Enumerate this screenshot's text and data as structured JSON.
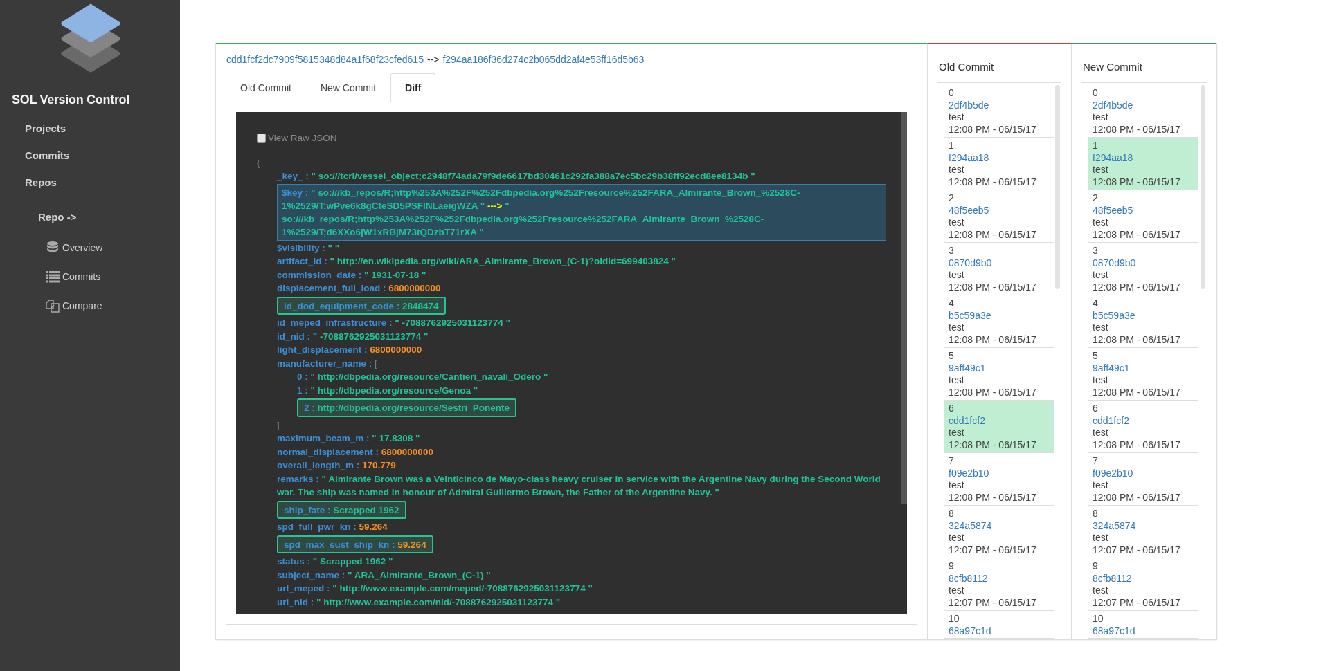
{
  "sidebar": {
    "title": "SOL Version Control",
    "nav": [
      {
        "label": "Projects"
      },
      {
        "label": "Commits"
      },
      {
        "label": "Repos"
      }
    ],
    "repo_heading": "Repo ->",
    "repo_items": [
      {
        "label": "Overview",
        "kind": "database"
      },
      {
        "label": "Commits",
        "kind": "list"
      },
      {
        "label": "Compare",
        "kind": "compare"
      }
    ]
  },
  "compare": {
    "old_hash": "cdd1fcf2dc7909f5815348d84a1f68f23cfed615",
    "arrow": "-->",
    "new_hash": "f294aa186f36d274c2b065dd2af4e53ff16d5b63"
  },
  "tabs": [
    {
      "label": "Old Commit",
      "selected": false
    },
    {
      "label": "New Commit",
      "selected": false
    },
    {
      "label": "Diff",
      "selected": true
    }
  ],
  "diff": {
    "raw_json": {
      "label": "View Raw JSON",
      "checked": false
    },
    "lines": [
      {
        "kind": "brace",
        "text": "{"
      },
      {
        "kind": "string",
        "key": "_key_ :",
        "value": "\" so:///tcri/vessel_object;c2948f74ada79f9de6617bd30461c292fa388a7ec5bc29b38ff92ecd8ee8134b \"",
        "highlighted": false
      },
      {
        "kind": "changed",
        "key": "$key :",
        "old": "\" so:///kb_repos/R;http%253A%252F%252Fdbpedia.org%252Fresource%252FARA_Almirante_Brown_%2528C-1%2529/T;wPve6k8gCteSD5PSFINLaeigWZA \"",
        "arrow": "--->",
        "new": "\" so:///kb_repos/R;http%253A%252F%252Fdbpedia.org%252Fresource%252FARA_Almirante_Brown_%2528C-1%2529/T;d6XXo6jW1xRBjM73tQDzbT71rXA \""
      },
      {
        "kind": "string",
        "key": "$visibility :",
        "value": "\" \"",
        "highlighted": false
      },
      {
        "kind": "string",
        "key": "artifact_id :",
        "value": "\" http://en.wikipedia.org/wiki/ARA_Almirante_Brown_(C-1)?oldid=699403824 \"",
        "highlighted": false
      },
      {
        "kind": "string",
        "key": "commission_date :",
        "value": "\" 1931-07-18 \"",
        "highlighted": false
      },
      {
        "kind": "number",
        "key": "displacement_full_load :",
        "value": "6800000000",
        "highlighted": false
      },
      {
        "kind": "string",
        "key": "id_dod_equipment_code :",
        "value": "2848474",
        "highlighted": true
      },
      {
        "kind": "string",
        "key": "id_meped_infrastructure :",
        "value": "\" -7088762925031123774 \"",
        "highlighted": false
      },
      {
        "kind": "string",
        "key": "id_nid :",
        "value": "\" -7088762925031123774 \"",
        "highlighted": false
      },
      {
        "kind": "number",
        "key": "light_displacement :",
        "value": "6800000000",
        "highlighted": false
      },
      {
        "kind": "array",
        "key": "manufacturer_name :",
        "open": "[",
        "close": "]",
        "items": [
          {
            "kind": "string",
            "key": "0 :",
            "value": "\" http://dbpedia.org/resource/Cantieri_navali_Odero \"",
            "highlighted": false
          },
          {
            "kind": "string",
            "key": "1 :",
            "value": "\" http://dbpedia.org/resource/Genoa \"",
            "highlighted": false
          },
          {
            "kind": "string",
            "key": "2 :",
            "value": "http://dbpedia.org/resource/Sestri_Ponente",
            "highlighted": true
          }
        ]
      },
      {
        "kind": "string",
        "key": "maximum_beam_m :",
        "value": "\" 17.8308 \"",
        "highlighted": false
      },
      {
        "kind": "number",
        "key": "normal_displacement :",
        "value": "6800000000",
        "highlighted": false
      },
      {
        "kind": "number",
        "key": "overall_length_m :",
        "value": "170.779",
        "highlighted": false
      },
      {
        "kind": "string",
        "key": "remarks :",
        "value": "\" Almirante Brown was a Veinticinco de Mayo-class heavy cruiser in service with the Argentine Navy during the Second World war. The ship was named in honour of Admiral Guillermo Brown, the Father of the Argentine Navy. \"",
        "highlighted": false
      },
      {
        "kind": "string",
        "key": "ship_fate :",
        "value": "Scrapped 1962",
        "highlighted": true
      },
      {
        "kind": "number",
        "key": "spd_full_pwr_kn :",
        "value": "59.264",
        "highlighted": false
      },
      {
        "kind": "number",
        "key": "spd_max_sust_ship_kn :",
        "value": "59.264",
        "highlighted": true
      },
      {
        "kind": "string",
        "key": "status :",
        "value": "\" Scrapped 1962 \"",
        "highlighted": false
      },
      {
        "kind": "string",
        "key": "subject_name :",
        "value": "\" ARA_Almirante_Brown_(C-1) \"",
        "highlighted": false
      },
      {
        "kind": "string",
        "key": "url_meped :",
        "value": "\" http://www.example.com/meped/-7088762925031123774 \"",
        "highlighted": false
      },
      {
        "kind": "string",
        "key": "url_nid :",
        "value": "\" http://www.example.com/nid/-7088762925031123774 \"",
        "highlighted": false
      }
    ]
  },
  "old_commit": {
    "title": "Old Commit",
    "items": [
      {
        "index": "0",
        "hash": "2df4b5de",
        "message": "test",
        "time": "12:08 PM - 06/15/17",
        "selected": false
      },
      {
        "index": "1",
        "hash": "f294aa18",
        "message": "test",
        "time": "12:08 PM - 06/15/17",
        "selected": false
      },
      {
        "index": "2",
        "hash": "48f5eeb5",
        "message": "test",
        "time": "12:08 PM - 06/15/17",
        "selected": false
      },
      {
        "index": "3",
        "hash": "0870d9b0",
        "message": "test",
        "time": "12:08 PM - 06/15/17",
        "selected": false
      },
      {
        "index": "4",
        "hash": "b5c59a3e",
        "message": "test",
        "time": "12:08 PM - 06/15/17",
        "selected": false
      },
      {
        "index": "5",
        "hash": "9aff49c1",
        "message": "test",
        "time": "12:08 PM - 06/15/17",
        "selected": false
      },
      {
        "index": "6",
        "hash": "cdd1fcf2",
        "message": "test",
        "time": "12:08 PM - 06/15/17",
        "selected": true
      },
      {
        "index": "7",
        "hash": "f09e2b10",
        "message": "test",
        "time": "12:08 PM - 06/15/17",
        "selected": false
      },
      {
        "index": "8",
        "hash": "324a5874",
        "message": "test",
        "time": "12:07 PM - 06/15/17",
        "selected": false
      },
      {
        "index": "9",
        "hash": "8cfb8112",
        "message": "test",
        "time": "12:07 PM - 06/15/17",
        "selected": false
      },
      {
        "index": "10",
        "hash": "68a97c1d",
        "selected": false
      }
    ]
  },
  "new_commit": {
    "title": "New Commit",
    "items": [
      {
        "index": "0",
        "hash": "2df4b5de",
        "message": "test",
        "time": "12:08 PM - 06/15/17",
        "selected": false
      },
      {
        "index": "1",
        "hash": "f294aa18",
        "message": "test",
        "time": "12:08 PM - 06/15/17",
        "selected": true
      },
      {
        "index": "2",
        "hash": "48f5eeb5",
        "message": "test",
        "time": "12:08 PM - 06/15/17",
        "selected": false
      },
      {
        "index": "3",
        "hash": "0870d9b0",
        "message": "test",
        "time": "12:08 PM - 06/15/17",
        "selected": false
      },
      {
        "index": "4",
        "hash": "b5c59a3e",
        "message": "test",
        "time": "12:08 PM - 06/15/17",
        "selected": false
      },
      {
        "index": "5",
        "hash": "9aff49c1",
        "message": "test",
        "time": "12:08 PM - 06/15/17",
        "selected": false
      },
      {
        "index": "6",
        "hash": "cdd1fcf2",
        "message": "test",
        "time": "12:08 PM - 06/15/17",
        "selected": false
      },
      {
        "index": "7",
        "hash": "f09e2b10",
        "message": "test",
        "time": "12:08 PM - 06/15/17",
        "selected": false
      },
      {
        "index": "8",
        "hash": "324a5874",
        "message": "test",
        "time": "12:07 PM - 06/15/17",
        "selected": false
      },
      {
        "index": "9",
        "hash": "8cfb8112",
        "message": "test",
        "time": "12:07 PM - 06/15/17",
        "selected": false
      },
      {
        "index": "10",
        "hash": "68a97c1d",
        "selected": false
      }
    ]
  }
}
